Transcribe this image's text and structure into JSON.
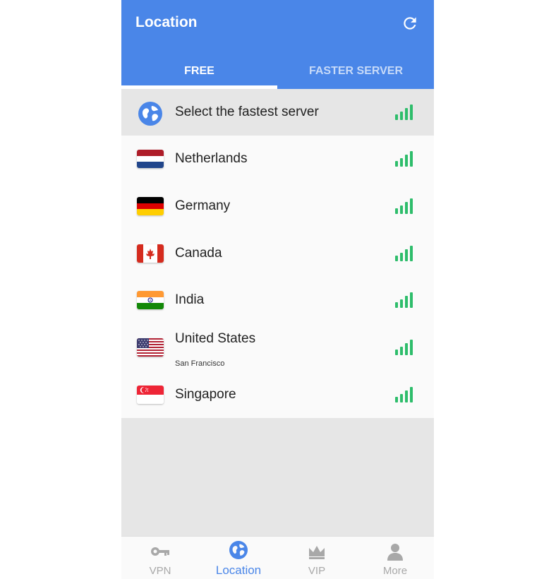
{
  "header": {
    "title": "Location"
  },
  "tabs": [
    {
      "label": "FREE",
      "active": true
    },
    {
      "label": "FASTER SERVER",
      "active": false
    }
  ],
  "servers": [
    {
      "name": "Select the fastest server",
      "sub": "",
      "icon": "globe-icon",
      "selected": true
    },
    {
      "name": "Netherlands",
      "sub": "",
      "icon": "netherlands-flag-icon"
    },
    {
      "name": "Germany",
      "sub": "",
      "icon": "germany-flag-icon"
    },
    {
      "name": "Canada",
      "sub": "",
      "icon": "canada-flag-icon"
    },
    {
      "name": "India",
      "sub": "",
      "icon": "india-flag-icon"
    },
    {
      "name": "United States",
      "sub": "San Francisco",
      "icon": "usa-flag-icon"
    },
    {
      "name": "Singapore",
      "sub": "",
      "icon": "singapore-flag-icon"
    }
  ],
  "bottom_nav": [
    {
      "label": "VPN",
      "icon": "key-icon",
      "active": false
    },
    {
      "label": "Location",
      "icon": "globe-icon",
      "active": true
    },
    {
      "label": "VIP",
      "icon": "crown-icon",
      "active": false
    },
    {
      "label": "More",
      "icon": "person-icon",
      "active": false
    }
  ],
  "colors": {
    "primary": "#4a86e8",
    "signal": "#2ebd6b",
    "inactive_nav": "#a8a8a8"
  }
}
